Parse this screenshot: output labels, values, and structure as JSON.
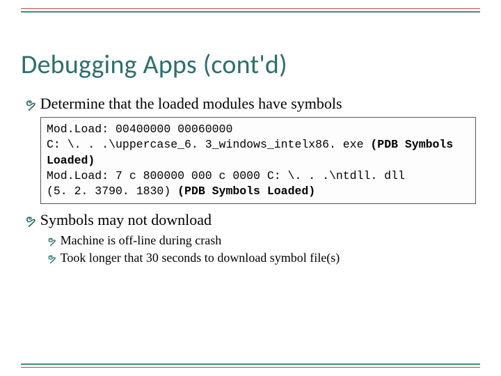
{
  "title": "Debugging Apps (cont'd)",
  "bullets": {
    "b1": "Determine that the loaded modules have symbols",
    "b2": "Symbols may not download",
    "b2a": "Machine is off-line during crash",
    "b2b": "Took longer that 30 seconds to download symbol file(s)"
  },
  "code": {
    "l1": "Mod.Load: 00400000 00060000",
    "l2a": "C: \\. . .\\uppercase_6. 3_windows_intelx86. exe ",
    "l2b": "(PDB Symbols Loaded)",
    "l3": "Mod.Load: 7 c 800000 000 c 0000 C: \\. . .\\ntdll. dll",
    "l4a": "(5. 2. 3790. 1830) ",
    "l4b": "(PDB Symbols Loaded)"
  }
}
